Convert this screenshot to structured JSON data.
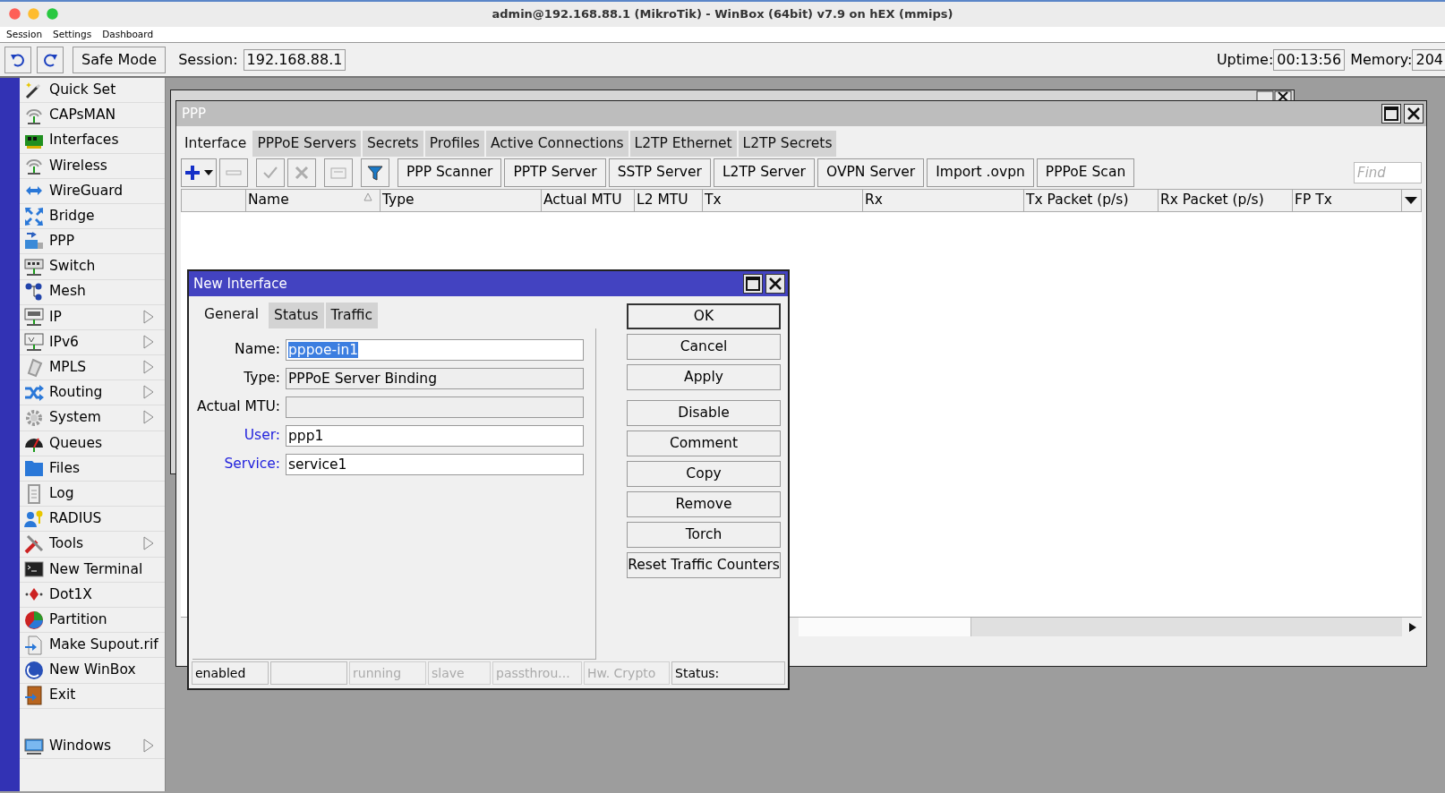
{
  "window": {
    "title": "admin@192.168.88.1 (MikroTik) - WinBox (64bit) v7.9 on hEX (mmips)"
  },
  "menu": [
    {
      "label": "Session"
    },
    {
      "label": "Settings"
    },
    {
      "label": "Dashboard"
    }
  ],
  "toolbar": {
    "safe_mode": "Safe Mode",
    "session_label": "Session:",
    "session": "192.168.88.1",
    "uptime_label": "Uptime:",
    "uptime": "00:13:56",
    "memory_label": "Memory:",
    "memory": "204"
  },
  "sidebar": {
    "items": [
      {
        "label": "Quick Set",
        "submenu": false
      },
      {
        "label": "CAPsMAN",
        "submenu": false
      },
      {
        "label": "Interfaces",
        "submenu": false
      },
      {
        "label": "Wireless",
        "submenu": false
      },
      {
        "label": "WireGuard",
        "submenu": false
      },
      {
        "label": "Bridge",
        "submenu": false
      },
      {
        "label": "PPP",
        "submenu": false
      },
      {
        "label": "Switch",
        "submenu": false
      },
      {
        "label": "Mesh",
        "submenu": false
      },
      {
        "label": "IP",
        "submenu": true
      },
      {
        "label": "IPv6",
        "submenu": true
      },
      {
        "label": "MPLS",
        "submenu": true
      },
      {
        "label": "Routing",
        "submenu": true
      },
      {
        "label": "System",
        "submenu": true
      },
      {
        "label": "Queues",
        "submenu": false
      },
      {
        "label": "Files",
        "submenu": false
      },
      {
        "label": "Log",
        "submenu": false
      },
      {
        "label": "RADIUS",
        "submenu": false
      },
      {
        "label": "Tools",
        "submenu": true
      },
      {
        "label": "New Terminal",
        "submenu": false
      },
      {
        "label": "Dot1X",
        "submenu": false
      },
      {
        "label": "Partition",
        "submenu": false
      },
      {
        "label": "Make Supout.rif",
        "submenu": false
      },
      {
        "label": "New WinBox",
        "submenu": false
      },
      {
        "label": "Exit",
        "submenu": false
      }
    ],
    "bottom_items": [
      {
        "label": "Windows",
        "submenu": true
      }
    ]
  },
  "ppp_window": {
    "title": "PPP",
    "tabs": [
      {
        "label": "Interface",
        "selected": true
      },
      {
        "label": "PPPoE Servers",
        "selected": false
      },
      {
        "label": "Secrets",
        "selected": false
      },
      {
        "label": "Profiles",
        "selected": false
      },
      {
        "label": "Active Connections",
        "selected": false
      },
      {
        "label": "L2TP Ethernet",
        "selected": false
      },
      {
        "label": "L2TP Secrets",
        "selected": false
      }
    ],
    "tool_icons": [
      {
        "disabled": false
      },
      {
        "disabled": true
      },
      {
        "disabled": true
      },
      {
        "disabled": true
      },
      {
        "disabled": true
      },
      {
        "disabled": false
      }
    ],
    "buttons": [
      "PPP Scanner",
      "PPTP Server",
      "SSTP Server",
      "L2TP Server",
      "OVPN Server",
      "Import .ovpn",
      "PPPoE Scan"
    ],
    "find": {
      "placeholder": "Find"
    },
    "columns": [
      {
        "sorted": false
      },
      {
        "label": "Name",
        "sorted": true
      },
      {
        "label": "Type",
        "sorted": false
      },
      {
        "label": "Actual MTU",
        "sorted": false
      },
      {
        "label": "L2 MTU",
        "sorted": false
      },
      {
        "label": "Tx",
        "sorted": false
      },
      {
        "label": "Rx",
        "sorted": false
      },
      {
        "label": "Tx Packet (p/s)",
        "sorted": false
      },
      {
        "label": "Rx Packet (p/s)",
        "sorted": false
      },
      {
        "label": "FP Tx",
        "sorted": false
      }
    ]
  },
  "dialog": {
    "title": "New Interface",
    "tabs": [
      {
        "label": "General",
        "selected": true
      },
      {
        "label": "Status",
        "selected": false
      },
      {
        "label": "Traffic",
        "selected": false
      }
    ],
    "fields": [
      {
        "label": "Name:",
        "value": "pppoe-in1",
        "link": false,
        "read_only": false,
        "text_selected": true
      },
      {
        "label": "Type:",
        "value": "PPPoE Server Binding",
        "link": false,
        "read_only": true
      },
      {
        "label": "Actual MTU:",
        "link": false,
        "read_only": true
      },
      {
        "label": "User:",
        "value": "ppp1",
        "link": true,
        "read_only": false
      },
      {
        "label": "Service:",
        "value": "service1",
        "link": true,
        "read_only": false
      }
    ],
    "button_groups": [
      [
        {
          "label": "OK",
          "default": true
        },
        {
          "label": "Cancel",
          "default": false
        },
        {
          "label": "Apply",
          "default": false
        }
      ],
      [
        {
          "label": "Disable",
          "default": false
        },
        {
          "label": "Comment",
          "default": false
        },
        {
          "label": "Copy",
          "default": false
        },
        {
          "label": "Remove",
          "default": false
        },
        {
          "label": "Torch",
          "default": false
        },
        {
          "label": "Reset Traffic Counters",
          "default": false
        }
      ]
    ],
    "status": [
      {
        "text": "enabled",
        "disabled": false
      },
      {
        "disabled": false
      },
      {
        "text": "running",
        "disabled": true
      },
      {
        "text": "slave",
        "disabled": true
      },
      {
        "text": "passthrou...",
        "disabled": true
      },
      {
        "text": "Hw. Crypto",
        "disabled": true
      },
      {
        "text": "Status:",
        "disabled": false
      }
    ]
  }
}
